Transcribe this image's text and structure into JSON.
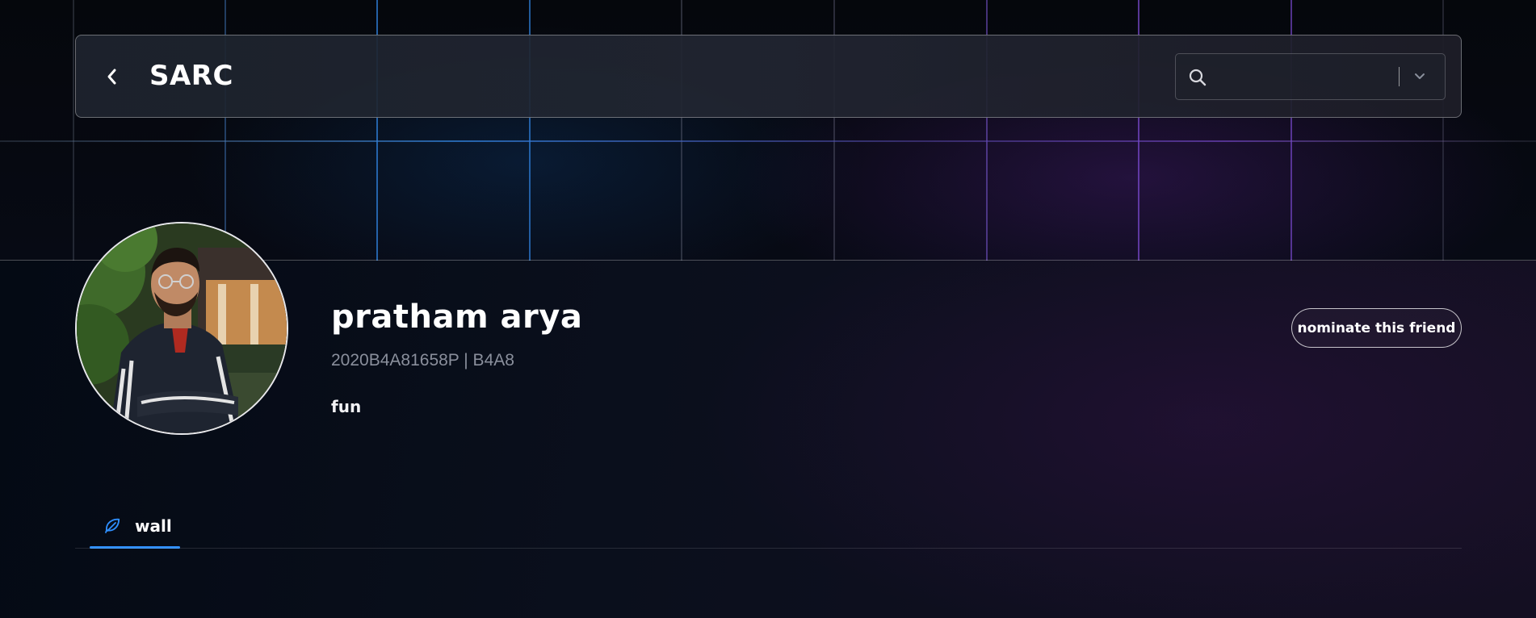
{
  "header": {
    "title": "SARC",
    "back_icon": "chevron-left-icon"
  },
  "search": {
    "placeholder": "",
    "value": "",
    "icon": "search-icon",
    "dropdown_icon": "chevron-down-icon"
  },
  "profile": {
    "name": "pratham arya",
    "id_line": "2020B4A81658P | B4A8",
    "bio": "fun",
    "avatar": "avatar-photo"
  },
  "actions": {
    "nominate_label": "nominate this friend"
  },
  "tabs": [
    {
      "label": "wall",
      "icon": "feather-icon",
      "active": true
    }
  ],
  "colors": {
    "accent": "#2f8fff",
    "background": "#05080f",
    "muted_text": "#8a8f9c"
  }
}
